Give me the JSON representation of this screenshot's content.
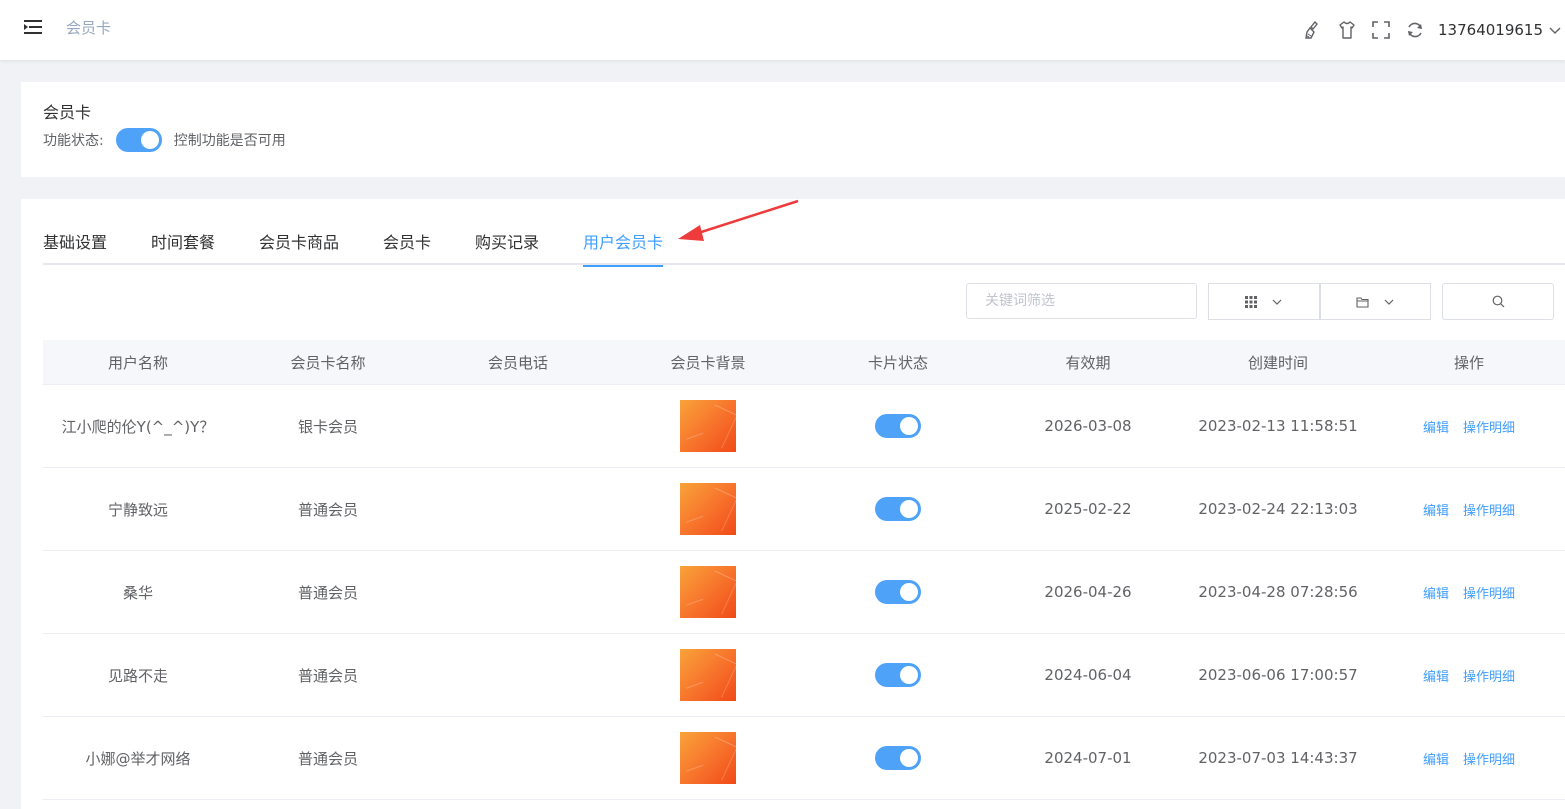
{
  "header": {
    "breadcrumb": "会员卡",
    "username": "13764019615",
    "icons": [
      "broom-icon",
      "tshirt-icon",
      "fullscreen-icon",
      "refresh-icon"
    ]
  },
  "feature": {
    "title": "会员卡",
    "status_label": "功能状态:",
    "status_on": true,
    "status_hint": "控制功能是否可用"
  },
  "tabs": [
    {
      "label": "基础设置",
      "active": false
    },
    {
      "label": "时间套餐",
      "active": false
    },
    {
      "label": "会员卡商品",
      "active": false
    },
    {
      "label": "会员卡",
      "active": false
    },
    {
      "label": "购买记录",
      "active": false
    },
    {
      "label": "用户会员卡",
      "active": true
    }
  ],
  "toolbar": {
    "search_placeholder": "关键词筛选"
  },
  "table": {
    "columns": [
      "用户名称",
      "会员卡名称",
      "会员电话",
      "会员卡背景",
      "卡片状态",
      "有效期",
      "创建时间",
      "操作"
    ],
    "rows": [
      {
        "user": "江小爬的伦Y(^_^)Y？",
        "card": "银卡会员",
        "phone": "",
        "enabled": true,
        "expire": "2026-03-08",
        "created": "2023-02-13 11:58:51"
      },
      {
        "user": "宁静致远",
        "card": "普通会员",
        "phone": "",
        "enabled": true,
        "expire": "2025-02-22",
        "created": "2023-02-24 22:13:03"
      },
      {
        "user": "桑华",
        "card": "普通会员",
        "phone": "",
        "enabled": true,
        "expire": "2026-04-26",
        "created": "2023-04-28 07:28:56"
      },
      {
        "user": "见路不走",
        "card": "普通会员",
        "phone": "",
        "enabled": true,
        "expire": "2024-06-04",
        "created": "2023-06-06 17:00:57"
      },
      {
        "user": "小娜@举才网络",
        "card": "普通会员",
        "phone": "",
        "enabled": true,
        "expire": "2024-07-01",
        "created": "2023-07-03 14:43:37"
      }
    ],
    "actions": {
      "edit": "编辑",
      "detail": "操作明细"
    }
  },
  "colors": {
    "primary": "#409eff",
    "switch_on": "#4ea2f8",
    "annotation_arrow": "#ee3b3b"
  }
}
